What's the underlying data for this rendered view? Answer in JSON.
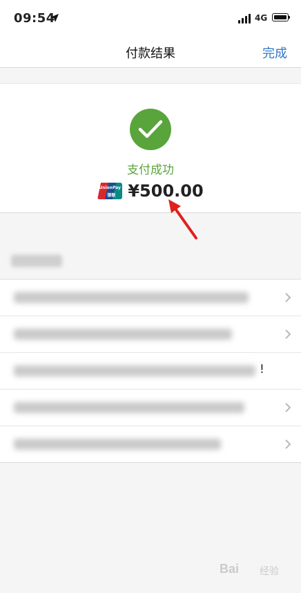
{
  "status_bar": {
    "time": "09:54",
    "network": "4G",
    "location_icon": "location-arrow-icon",
    "signal_icon": "signal-bars-icon",
    "battery_icon": "battery-icon"
  },
  "nav": {
    "title": "付款结果",
    "done_label": "完成"
  },
  "result": {
    "status_icon": "checkmark-circle-icon",
    "status_text": "支付成功",
    "payment_logo": "unionpay-logo",
    "logo_text_top": "UnionPay",
    "logo_text_bottom": "银联",
    "amount": "¥500.00"
  },
  "details": {
    "rows": [
      {
        "trailing": ""
      },
      {
        "trailing": ""
      },
      {
        "trailing": "!"
      },
      {
        "trailing": ""
      },
      {
        "trailing": ""
      }
    ]
  },
  "watermark": {
    "text": "Bai",
    "sub_text": "经验"
  },
  "colors": {
    "success_green": "#5aa43c",
    "link_blue": "#2f77c8",
    "annotation_red": "#e0201f",
    "background": "#f5f5f5"
  }
}
